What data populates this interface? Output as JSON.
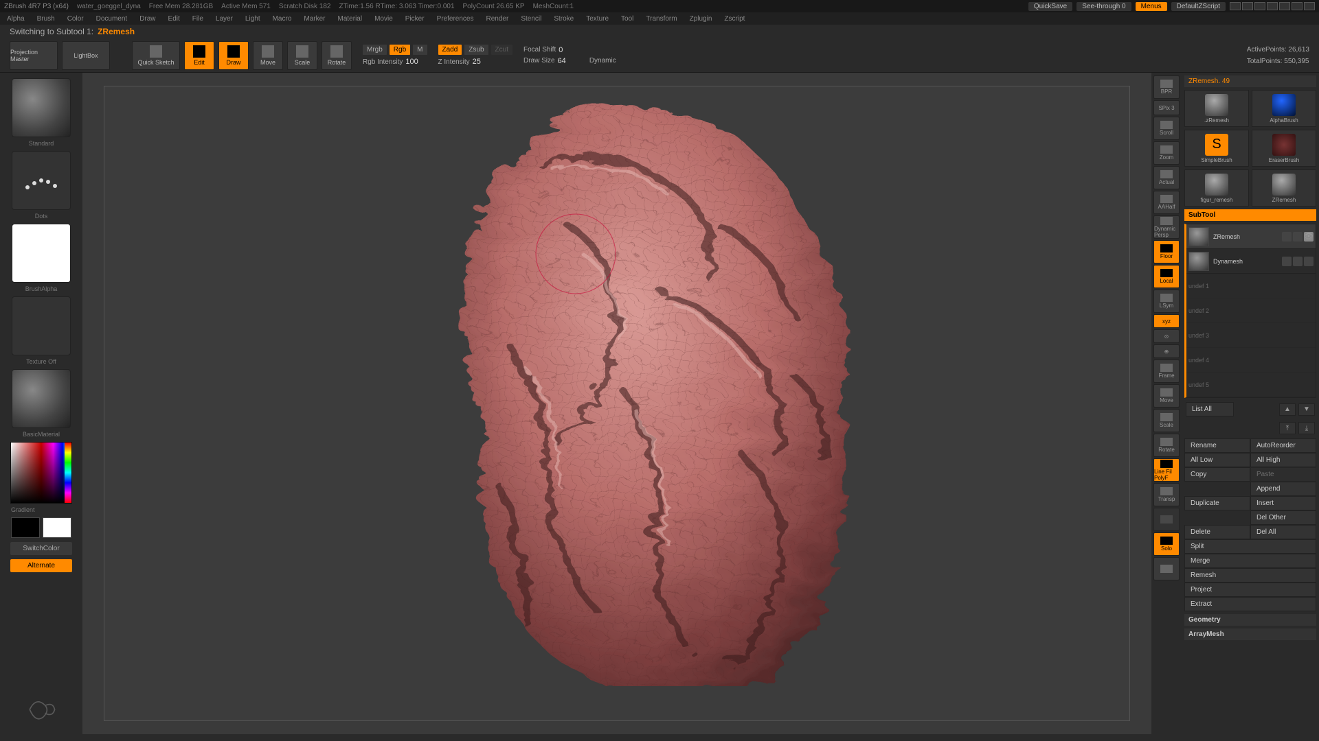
{
  "titlebar": {
    "app": "ZBrush 4R7 P3 (x64)",
    "doc": "water_goeggel_dyna",
    "stats": [
      "Free Mem 28.281GB",
      "Active Mem 571",
      "Scratch Disk 182",
      "ZTime:1.56 RTime: 3.063 Timer:0.001",
      "PolyCount 26.65 KP",
      "MeshCount:1"
    ],
    "quicksave": "QuickSave",
    "seethrough": "See-through   0",
    "menus": "Menus",
    "script": "DefaultZScript"
  },
  "menubar": [
    "Alpha",
    "Brush",
    "Color",
    "Document",
    "Draw",
    "Edit",
    "File",
    "Layer",
    "Light",
    "Macro",
    "Marker",
    "Material",
    "Movie",
    "Picker",
    "Preferences",
    "Render",
    "Stencil",
    "Stroke",
    "Texture",
    "Tool",
    "Transform",
    "Zplugin",
    "Zscript"
  ],
  "status": {
    "prefix": "Switching to Subtool 1:",
    "name": "ZRemesh"
  },
  "toolbar": {
    "projmaster": "Projection\nMaster",
    "lightbox": "LightBox",
    "quicksketch": "Quick\nSketch",
    "edit": "Edit",
    "draw": "Draw",
    "move": "Move",
    "scale": "Scale",
    "rotate": "Rotate",
    "mrgb": "Mrgb",
    "rgb": "Rgb",
    "m": "M",
    "rgbint": "Rgb Intensity",
    "rgbintv": "100",
    "zadd": "Zadd",
    "zsub": "Zsub",
    "zcut": "Zcut",
    "zint": "Z Intensity",
    "zintv": "25",
    "focal": "Focal Shift",
    "focalv": "0",
    "drawsize": "Draw Size",
    "drawsizev": "64",
    "dynamic": "Dynamic",
    "activepts": "ActivePoints:",
    "activeptsv": "26,613",
    "totalpts": "TotalPoints:",
    "totalptsv": "550,395"
  },
  "left": {
    "brush": "Standard",
    "stroke": "Dots",
    "alpha": "BrushAlpha",
    "texture": "Texture Off",
    "material": "BasicMaterial",
    "gradient": "Gradient",
    "switchcolor": "SwitchColor",
    "alternate": "Alternate"
  },
  "rightstrip": {
    "bpr": "BPR",
    "spix": "SPix 3",
    "items": [
      "Scroll",
      "Zoom",
      "Actual",
      "AAHalf",
      "Dynamic Persp",
      "",
      "Floor",
      "Local",
      "LSym",
      "xyz",
      "",
      "",
      "Frame",
      "Move",
      "Scale",
      "Rotate",
      "Line Fil PolyF",
      "Transp",
      "",
      "Solo",
      ""
    ]
  },
  "tools": {
    "toolname": "ZRemesh. 49",
    "grid": [
      ".zRemesh",
      "AlphaBrush",
      "SimpleBrush",
      "EraserBrush",
      "figur_remesh",
      "ZRemesh"
    ]
  },
  "subtool": {
    "head": "SubTool",
    "items": [
      {
        "name": "ZRemesh",
        "sel": true
      },
      {
        "name": "Dynamesh",
        "sel": false
      },
      {
        "name": "undef 1",
        "dim": true
      },
      {
        "name": "undef 2",
        "dim": true
      },
      {
        "name": "undef 3",
        "dim": true
      },
      {
        "name": "undef 4",
        "dim": true
      },
      {
        "name": "undef 5",
        "dim": true
      }
    ],
    "listall": "List All",
    "actions": [
      [
        "Rename",
        "AutoReorder"
      ],
      [
        "All Low",
        "All High"
      ],
      [
        "Copy",
        "Paste"
      ],
      [
        "",
        "Append"
      ],
      [
        "Duplicate",
        "Insert"
      ],
      [
        "",
        "Del Other"
      ],
      [
        "Delete",
        "Del All"
      ],
      [
        "Split",
        ""
      ],
      [
        "Merge",
        ""
      ],
      [
        "Remesh",
        ""
      ],
      [
        "Project",
        ""
      ],
      [
        "Extract",
        ""
      ]
    ],
    "geometry": "Geometry",
    "arraymesh": "ArrayMesh"
  }
}
